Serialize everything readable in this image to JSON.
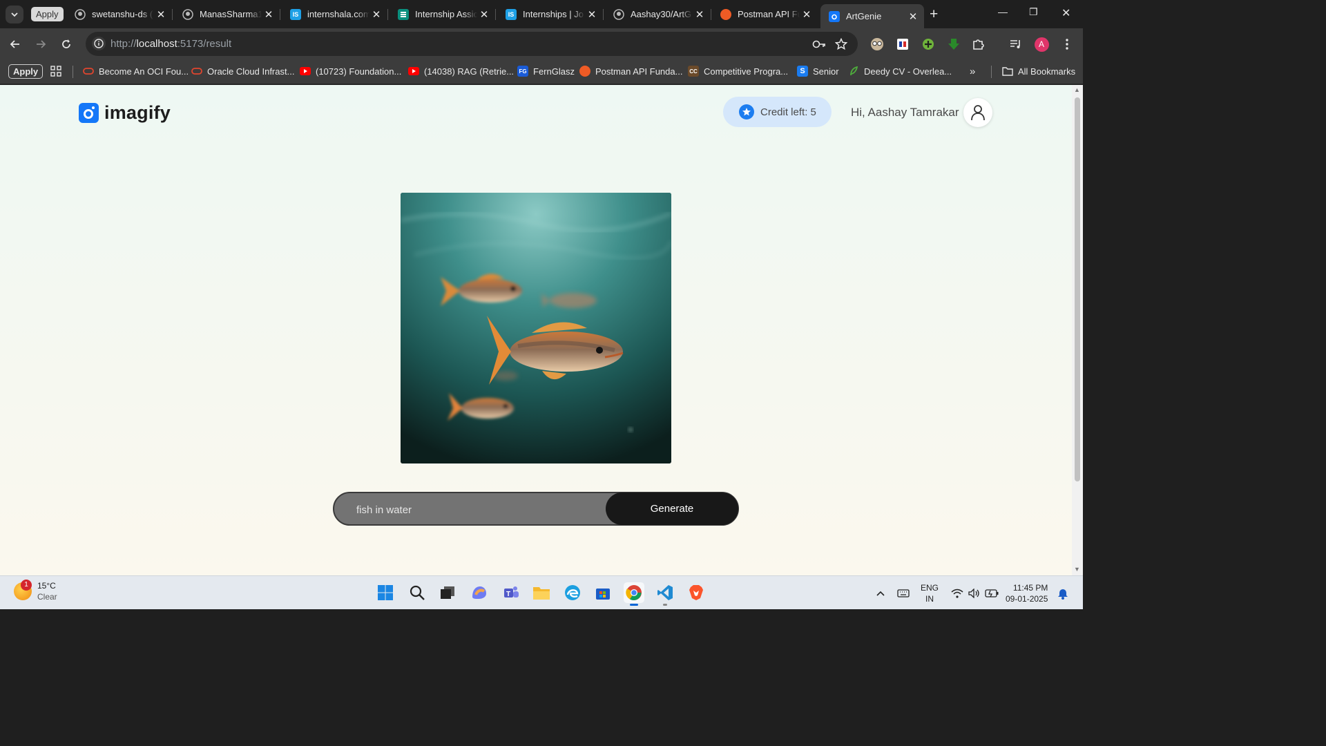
{
  "browser": {
    "tabs": [
      {
        "label": "swetanshu-ds (",
        "icon": "github-icon"
      },
      {
        "label": "ManasSharma1",
        "icon": "github-icon"
      },
      {
        "label": "internshala.com",
        "icon": "internshala-icon"
      },
      {
        "label": "Internship Assic",
        "icon": "forms-icon"
      },
      {
        "label": "Internships | Jo",
        "icon": "internshala-icon"
      },
      {
        "label": "Aashay30/ArtG",
        "icon": "github-icon"
      },
      {
        "label": "Postman API Fu",
        "icon": "postman-icon"
      },
      {
        "label": "ArtGenie",
        "icon": "imagify-icon",
        "active": true
      }
    ],
    "apply_chip": "Apply",
    "url_prefix": "http://",
    "url_host": "localhost",
    "url_rest": ":5173/result",
    "profile_initial": "A",
    "bookmarks": [
      {
        "label": "Become An OCI Fou...",
        "icon": "oracle-icon"
      },
      {
        "label": "Oracle Cloud Infrast...",
        "icon": "oracle-icon"
      },
      {
        "label": "(10723) Foundation...",
        "icon": "youtube-icon"
      },
      {
        "label": "(14038) RAG (Retrie...",
        "icon": "youtube-icon"
      },
      {
        "label": "FernGlasz",
        "icon": "fg-icon"
      },
      {
        "label": "Postman API Funda...",
        "icon": "postman-icon"
      },
      {
        "label": "Competitive Progra...",
        "icon": "cc-icon"
      },
      {
        "label": "Senior",
        "icon": "s-icon"
      },
      {
        "label": "Deedy CV - Overlea...",
        "icon": "overleaf-icon"
      }
    ],
    "apply_bookmark": "Apply",
    "all_bookmarks": "All Bookmarks",
    "fg_badge": "FG",
    "cc_badge": "CC",
    "s_badge": "S",
    "is_badge": "IS"
  },
  "app": {
    "logo_text": "imagify",
    "credit_text": "Credit left: 5",
    "greeting": "Hi, Aashay Tamrakar",
    "prompt_value": "fish in water",
    "generate_label": "Generate",
    "accent": "#1477f8"
  },
  "taskbar": {
    "temperature": "15°C",
    "condition": "Clear",
    "weather_badge": "1",
    "lang_line1": "ENG",
    "lang_line2": "IN",
    "time": "11:45 PM",
    "date": "09-01-2025"
  }
}
